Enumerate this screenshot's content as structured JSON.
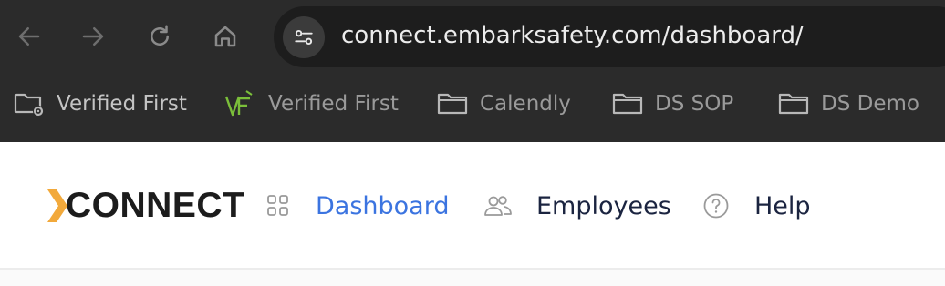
{
  "browser": {
    "url": "connect.embarksafety.com/dashboard/",
    "nav_icons": [
      "back-arrow-icon",
      "forward-arrow-icon",
      "reload-icon",
      "home-icon"
    ],
    "bookmarks": [
      {
        "label": "Verified First",
        "icon": "folder-gear-icon"
      },
      {
        "label": "Verified First",
        "icon": "verified-first-logo-icon"
      },
      {
        "label": "Calendly",
        "icon": "folder-icon"
      },
      {
        "label": "DS SOP",
        "icon": "folder-icon"
      },
      {
        "label": "DS Demo",
        "icon": "folder-icon"
      }
    ]
  },
  "app": {
    "brand": "CONNECT",
    "accent_color": "#f2a93b",
    "nav": [
      {
        "label": "Dashboard",
        "icon": "grid-icon",
        "active": true,
        "color": "#3b74e0"
      },
      {
        "label": "Employees",
        "icon": "users-icon",
        "active": false,
        "color": "#1b2440"
      },
      {
        "label": "Help",
        "icon": "help-circle-icon",
        "active": false,
        "color": "#1b2440"
      }
    ]
  }
}
